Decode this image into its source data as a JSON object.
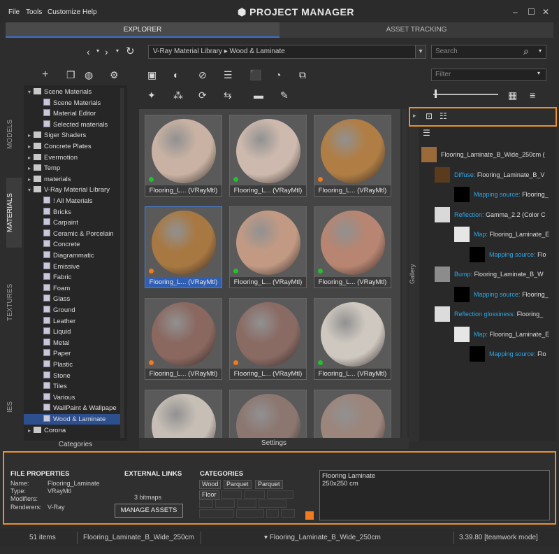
{
  "app": {
    "title": "PROJECT MANAGER"
  },
  "menu": [
    "File",
    "Tools",
    "Customize",
    "Help"
  ],
  "window_controls": {
    "minimize": "–",
    "maximize": "☐",
    "close": "✕"
  },
  "tabs": [
    {
      "label": "EXPLORER",
      "active": true
    },
    {
      "label": "ASSET TRACKING",
      "active": false
    }
  ],
  "path": {
    "root": "V-Ray Material Library",
    "separator": "▸",
    "current": "Wood & Laminate"
  },
  "search": {
    "placeholder": "Search"
  },
  "filter": {
    "placeholder": "Filter"
  },
  "side_tabs": [
    "MODELS",
    "MATERIALS",
    "TEXTURES",
    "IES"
  ],
  "tree": [
    {
      "label": "Scene Materials",
      "type": "folder",
      "expanded": true,
      "level": 0
    },
    {
      "label": "Scene Materials",
      "type": "mat",
      "level": 1
    },
    {
      "label": "Material Editor",
      "type": "mat",
      "level": 1
    },
    {
      "label": "Selected materials",
      "type": "mat",
      "level": 1
    },
    {
      "label": "Siger Shaders",
      "type": "folder",
      "level": 0
    },
    {
      "label": "Concrete Plates",
      "type": "folder",
      "level": 0
    },
    {
      "label": "Evermotion",
      "type": "folder",
      "level": 0
    },
    {
      "label": "Temp",
      "type": "folder",
      "level": 0
    },
    {
      "label": "materials",
      "type": "folder",
      "level": 0
    },
    {
      "label": "V-Ray Material Library",
      "type": "folder",
      "expanded": true,
      "level": 0
    },
    {
      "label": "! All Materials",
      "type": "mat",
      "level": 1
    },
    {
      "label": "Bricks",
      "type": "mat",
      "level": 1
    },
    {
      "label": "Carpaint",
      "type": "mat",
      "level": 1
    },
    {
      "label": "Ceramic & Porcelain",
      "type": "mat",
      "level": 1
    },
    {
      "label": "Concrete",
      "type": "mat",
      "level": 1
    },
    {
      "label": "Diagrammatic",
      "type": "mat",
      "level": 1
    },
    {
      "label": "Emissive",
      "type": "mat",
      "level": 1
    },
    {
      "label": "Fabric",
      "type": "mat",
      "level": 1
    },
    {
      "label": "Foam",
      "type": "mat",
      "level": 1
    },
    {
      "label": "Glass",
      "type": "mat",
      "level": 1
    },
    {
      "label": "Ground",
      "type": "mat",
      "level": 1
    },
    {
      "label": "Leather",
      "type": "mat",
      "level": 1
    },
    {
      "label": "Liquid",
      "type": "mat",
      "level": 1
    },
    {
      "label": "Metal",
      "type": "mat",
      "level": 1
    },
    {
      "label": "Paper",
      "type": "mat",
      "level": 1
    },
    {
      "label": "Plastic",
      "type": "mat",
      "level": 1
    },
    {
      "label": "Stone",
      "type": "mat",
      "level": 1
    },
    {
      "label": "Tiles",
      "type": "mat",
      "level": 1
    },
    {
      "label": "Various",
      "type": "mat",
      "level": 1
    },
    {
      "label": "WallPaint & Wallpape",
      "type": "mat",
      "level": 1
    },
    {
      "label": "Wood & Laminate",
      "type": "mat",
      "level": 1,
      "selected": true
    },
    {
      "label": "Corona",
      "type": "folder",
      "level": 0
    }
  ],
  "tree_footer": "Categories",
  "grid_footer": "Settings",
  "gallery_label": "Gallery",
  "materials": [
    {
      "label": "Flooring_L... (VRayMtl)",
      "color": "#c9b2a3",
      "dot": "#22c12b"
    },
    {
      "label": "Flooring_L... (VRayMtl)",
      "color": "#cdb9ad",
      "dot": "#22c12b"
    },
    {
      "label": "Flooring_L... (VRayMtl)",
      "color": "#b07e45",
      "dot": "#f07a1e"
    },
    {
      "label": "Flooring_L... (VRayMtl)",
      "color": "#a87842",
      "dot": "#f07a1e",
      "selected": true
    },
    {
      "label": "Flooring_L... (VRayMtl)",
      "color": "#c29a84",
      "dot": "#22c12b"
    },
    {
      "label": "Flooring_L... (VRayMtl)",
      "color": "#b78571",
      "dot": "#22c12b"
    },
    {
      "label": "Flooring_L... (VRayMtl)",
      "color": "#8a6860",
      "dot": "#f07a1e"
    },
    {
      "label": "Flooring_L... (VRayMtl)",
      "color": "#8a6b64",
      "dot": "#f07a1e"
    },
    {
      "label": "Flooring_L... (VRayMtl)",
      "color": "#cfc8c0",
      "dot": "#22c12b"
    },
    {
      "label": "",
      "color": "#c7bfb6",
      "dot": ""
    },
    {
      "label": "",
      "color": "#8c7670",
      "dot": ""
    },
    {
      "label": "",
      "color": "#9c857b",
      "dot": ""
    }
  ],
  "properties_tree": [
    {
      "key": "",
      "value": "Flooring_Laminate_B_Wide_250cm (",
      "thumb": "#9b6a3a"
    },
    {
      "key": "Diffuse:",
      "value": "Flooring_Laminate_B_V",
      "thumb": "#5a3b1d"
    },
    {
      "key": "Mapping source:",
      "value": "Flooring_",
      "thumb": "#000000"
    },
    {
      "key": "Reflection:",
      "value": "Gamma_2.2 (Color C",
      "thumb": "#d9d9d9"
    },
    {
      "key": "Map:",
      "value": "Flooring_Laminate_E",
      "thumb": "#e6e6e6"
    },
    {
      "key": "Mapping source:",
      "value": "Flo",
      "thumb": "#000000"
    },
    {
      "key": "Bump:",
      "value": "Flooring_Laminate_B_W",
      "thumb": "#8c8c8c"
    },
    {
      "key": "Mapping source:",
      "value": "Flooring_",
      "thumb": "#000000"
    },
    {
      "key": "Reflection glossiness:",
      "value": "Flooring_",
      "thumb": "#dcdcdc"
    },
    {
      "key": "Map:",
      "value": "Flooring_Laminate_E",
      "thumb": "#e6e6e6"
    },
    {
      "key": "Mapping source:",
      "value": "Flo",
      "thumb": "#000000"
    }
  ],
  "file_properties": {
    "title": "FILE PROPERTIES",
    "name_label": "Name:",
    "name": "Flooring_Laminate",
    "type_label": "Type:",
    "type": "VRayMtl",
    "modifiers_label": "Modifiers:",
    "renderers_label": "Renderers:",
    "renderers": "V-Ray"
  },
  "external_links": {
    "title": "EXTERNAL LINKS",
    "bitmaps": "3 bitmaps",
    "manage": "MANAGE ASSETS"
  },
  "categories": {
    "title": "CATEGORIES",
    "tags": [
      "Wood",
      "Parquet",
      "Parquet",
      "Floor"
    ],
    "color": "#f07a1e"
  },
  "notes": {
    "line1": "Flooring Laminate",
    "line2": "250x250 cm"
  },
  "status": {
    "count": "51 items",
    "selected": "Flooring_Laminate_B_Wide_250cm",
    "path": "▾ Flooring_Laminate_B_Wide_250cm",
    "version": "3.39.80 [teamwork mode]"
  }
}
